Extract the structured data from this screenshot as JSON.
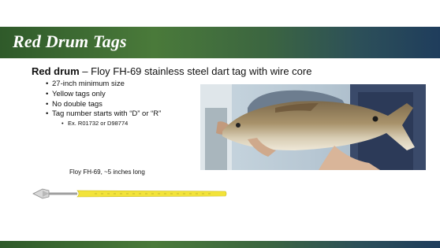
{
  "slide": {
    "title": "Red Drum Tags",
    "heading_bold": "Red drum",
    "heading_rest": " – Floy FH-69 stainless steel dart tag with wire core",
    "bullets": [
      "27-inch minimum size",
      "Yellow tags only",
      "No double tags",
      "Tag number starts with “D” or “R”"
    ],
    "sub_bullet": "Ex. R01732 or D98774",
    "bullet_glyph": "•",
    "sub_bullet_glyph": "•",
    "tag_caption": "Floy FH-69, ~5 inches long"
  },
  "colors": {
    "title_bar_start": "#2f5a2a",
    "title_bar_end": "#1f3d5c",
    "tag_yellow": "#f2e33a"
  }
}
